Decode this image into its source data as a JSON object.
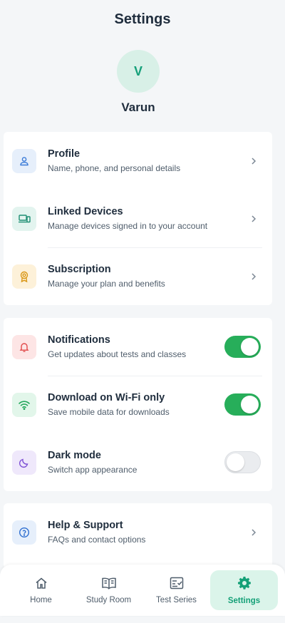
{
  "header": {
    "title": "Settings"
  },
  "profile": {
    "initial": "V",
    "name": "Varun"
  },
  "account_section": [
    {
      "title": "Profile",
      "subtitle": "Name, phone, and personal details",
      "icon": "user-icon"
    },
    {
      "title": "Linked Devices",
      "subtitle": "Manage devices signed in to your account",
      "icon": "devices-icon"
    },
    {
      "title": "Subscription",
      "subtitle": "Manage your plan and benefits",
      "icon": "badge-icon"
    }
  ],
  "preferences_section": [
    {
      "title": "Notifications",
      "subtitle": "Get updates about tests and classes",
      "icon": "bell-icon",
      "enabled": true
    },
    {
      "title": "Download on Wi-Fi only",
      "subtitle": "Save mobile data for downloads",
      "icon": "wifi-icon",
      "enabled": true
    },
    {
      "title": "Dark mode",
      "subtitle": "Switch app appearance",
      "icon": "moon-icon",
      "enabled": false
    }
  ],
  "support_section": [
    {
      "title": "Help & Support",
      "subtitle": "FAQs and contact options",
      "icon": "help-icon"
    }
  ],
  "bottom_nav": [
    {
      "label": "Home",
      "icon": "home-icon"
    },
    {
      "label": "Study Room",
      "icon": "book-icon"
    },
    {
      "label": "Test Series",
      "icon": "checklist-icon"
    },
    {
      "label": "Settings",
      "icon": "gear-icon",
      "active": true
    }
  ],
  "colors": {
    "accent": "#14a077",
    "toggle_on": "#27ae5a",
    "background": "#f4f6f8"
  }
}
